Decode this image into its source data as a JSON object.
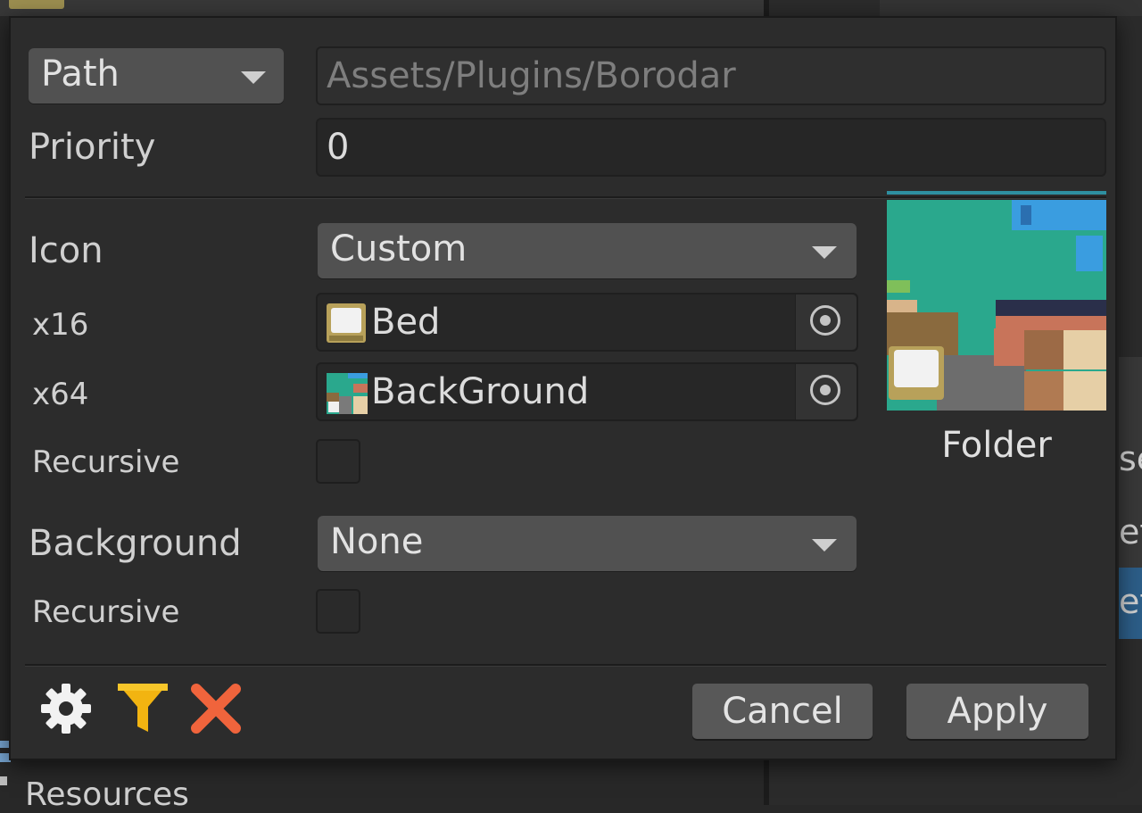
{
  "background_window": {
    "folder_item_label": "Resources",
    "right_list_fragments": [
      "se",
      "et",
      "et"
    ]
  },
  "popup": {
    "path_row": {
      "mode_dropdown": "Path",
      "path_value": "Assets/Plugins/Borodar"
    },
    "priority_row": {
      "label": "Priority",
      "value": "0"
    },
    "icon_row": {
      "label": "Icon",
      "dropdown_value": "Custom"
    },
    "x16_row": {
      "label": "x16",
      "object_name": "Bed",
      "object_icon": "bed-sprite-icon"
    },
    "x64_row": {
      "label": "x64",
      "object_name": "BackGround",
      "object_icon": "background-sprite-icon"
    },
    "icon_recursive": {
      "label": "Recursive",
      "checked": false
    },
    "background_row": {
      "label": "Background",
      "dropdown_value": "None"
    },
    "background_recursive": {
      "label": "Recursive",
      "checked": false
    },
    "preview": {
      "caption": "Folder"
    },
    "footer": {
      "settings_icon": "gear-icon",
      "filter_icon": "funnel-icon",
      "delete_icon": "close-x-icon",
      "cancel_label": "Cancel",
      "apply_label": "Apply"
    }
  },
  "colors": {
    "panel_bg": "#2c2c2c",
    "dropdown_bg": "#515151",
    "field_bg": "#262626",
    "filter_yellow": "#f2b411",
    "delete_orange": "#f0643c",
    "gear_white": "#f2f2f2",
    "selection_blue": "#2c5d87"
  }
}
